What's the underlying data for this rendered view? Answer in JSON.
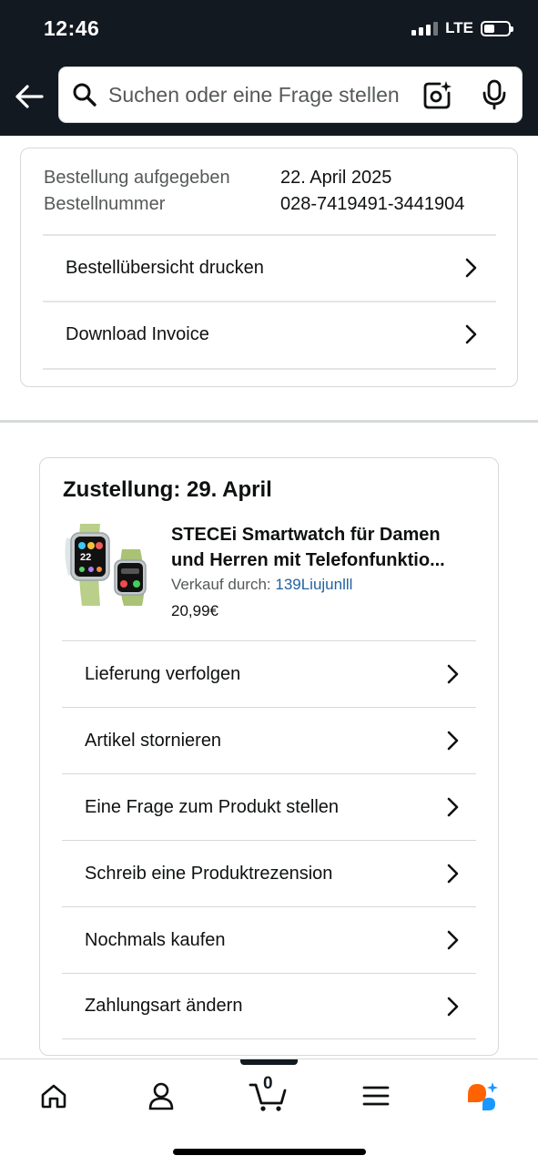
{
  "status_bar": {
    "time": "12:46",
    "network": "LTE"
  },
  "header": {
    "search_placeholder": "Suchen oder eine Frage stellen",
    "back_icon": "arrow-left-icon",
    "camera_icon": "camera-sparkle-icon",
    "mic_icon": "microphone-icon"
  },
  "order_info": {
    "placed_label": "Bestellung aufgegeben",
    "placed_value": "22. April 2025",
    "number_label": "Bestellnummer",
    "number_value": "028-7419491-3441904",
    "links": [
      {
        "label": "Bestellübersicht drucken"
      },
      {
        "label": "Download Invoice"
      }
    ]
  },
  "delivery": {
    "title": "Zustellung: 29. April",
    "product": {
      "title_line1": "STECEi Smartwatch für Damen",
      "title_line2": "und Herren mit Telefonfunktio...",
      "seller_label": "Verkauf durch:",
      "seller_name": "139Liujunlll",
      "price": "20,99€",
      "image_alt": "smartwatch-product-image"
    },
    "actions": [
      {
        "label": "Lieferung verfolgen"
      },
      {
        "label": "Artikel stornieren"
      },
      {
        "label": "Eine Frage zum Produkt stellen"
      },
      {
        "label": "Schreib eine Produktrezension"
      },
      {
        "label": "Nochmals kaufen"
      },
      {
        "label": "Zahlungsart ändern"
      }
    ]
  },
  "bottom_nav": {
    "cart_count": "0",
    "items": [
      "home-icon",
      "account-icon",
      "cart-icon",
      "menu-icon",
      "rufus-ai-icon"
    ]
  },
  "colors": {
    "header_bg": "#131921",
    "link_blue": "#2162a1",
    "rufus_orange": "#ff6200",
    "rufus_blue": "#1a98ff"
  }
}
